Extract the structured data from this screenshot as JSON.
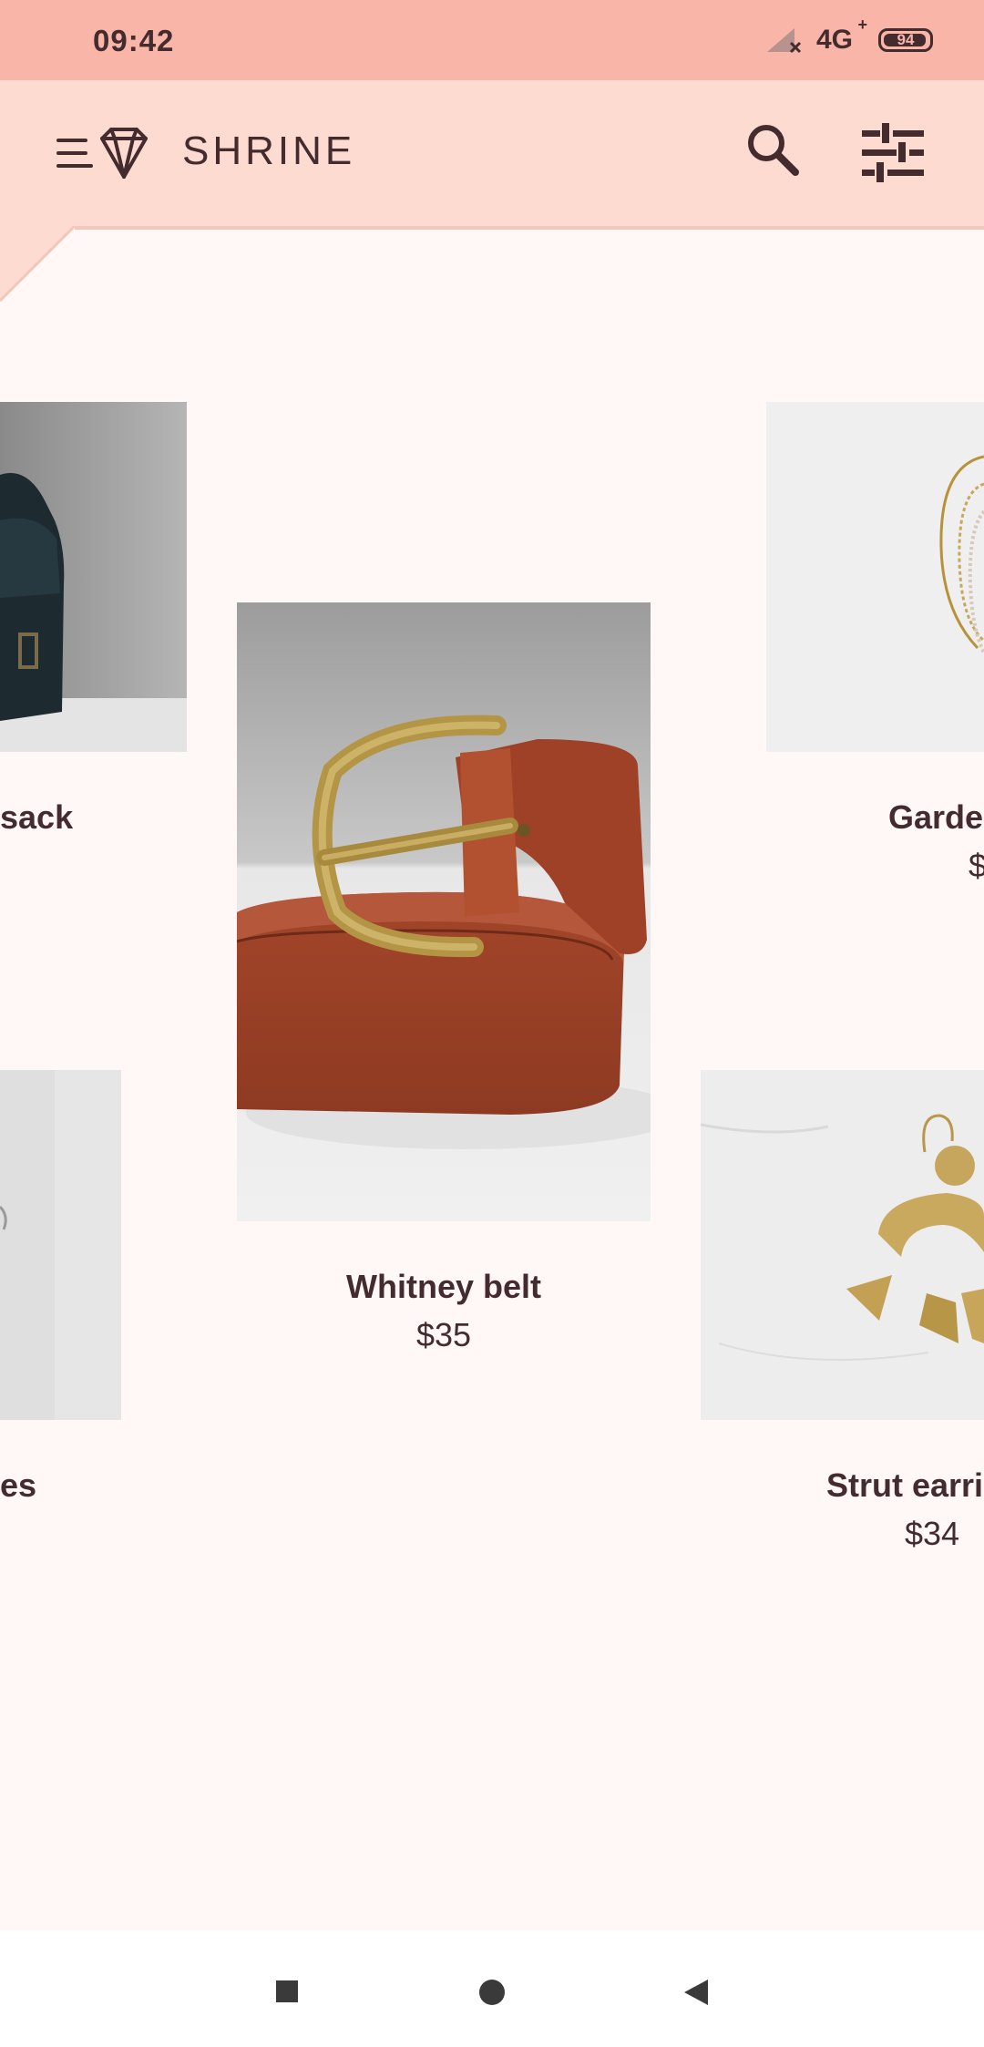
{
  "status_bar": {
    "time": "09:42",
    "network": "4G",
    "network_suffix": "+",
    "battery": "94"
  },
  "app_bar": {
    "title": "SHRINE",
    "menu_icon": "menu-diamond-icon",
    "search_icon": "search-icon",
    "filter_icon": "tune-icon"
  },
  "products": [
    {
      "name": "sack",
      "price": ""
    },
    {
      "name": "Garde",
      "price": "$"
    },
    {
      "name": "Whitney belt",
      "price": "$35"
    },
    {
      "name": "es",
      "price": ""
    },
    {
      "name": "Strut earri",
      "price": "$34"
    }
  ],
  "colors": {
    "status_bar": "#F9B5A8",
    "app_bar": "#FEDBD0",
    "background": "#FFF8F6",
    "text": "#442C2E"
  },
  "nav": {
    "recents_icon": "square-icon",
    "home_icon": "circle-icon",
    "back_icon": "triangle-back-icon"
  }
}
